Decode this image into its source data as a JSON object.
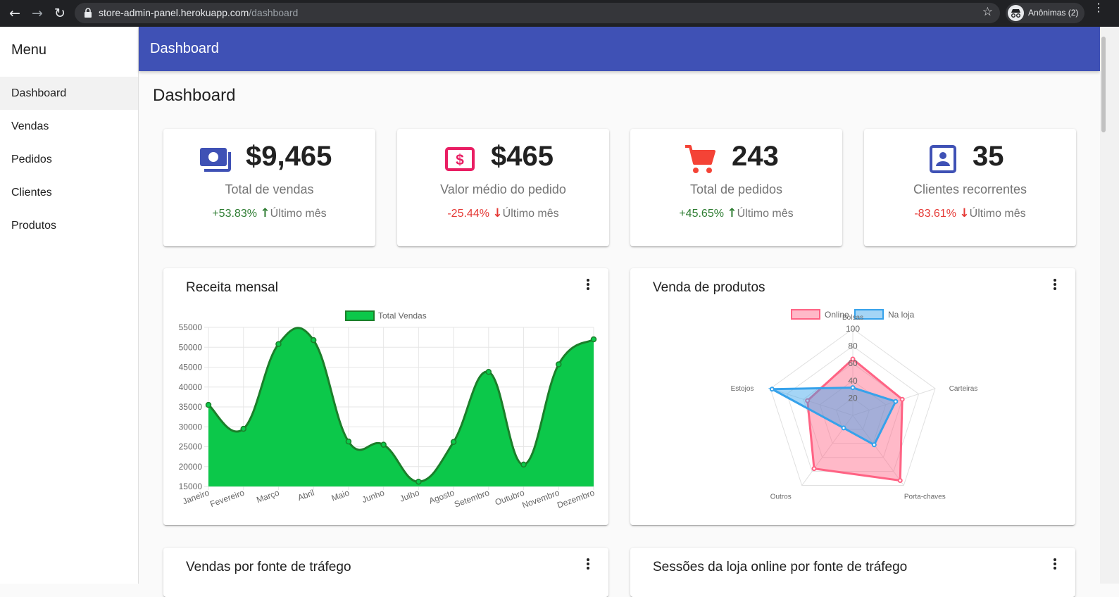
{
  "browser": {
    "url_host": "store-admin-panel.herokuapp.com",
    "url_path": "/dashboard",
    "profile_label": "Anônimas (2)"
  },
  "sidebar": {
    "title": "Menu",
    "items": [
      {
        "label": "Dashboard",
        "active": true
      },
      {
        "label": "Vendas",
        "active": false
      },
      {
        "label": "Pedidos",
        "active": false
      },
      {
        "label": "Clientes",
        "active": false
      },
      {
        "label": "Produtos",
        "active": false
      }
    ]
  },
  "appbar": {
    "title": "Dashboard"
  },
  "page": {
    "heading": "Dashboard"
  },
  "stats": [
    {
      "icon": "money-icon",
      "value": "$9,465",
      "label": "Total de vendas",
      "change": "+53.83%",
      "direction": "up",
      "period": "Último mês",
      "color": "#3f51b5"
    },
    {
      "icon": "dollar-icon",
      "value": "$465",
      "label": "Valor médio do pedido",
      "change": "-25.44%",
      "direction": "down",
      "period": "Último mês",
      "color": "#e91e63"
    },
    {
      "icon": "cart-icon",
      "value": "243",
      "label": "Total de pedidos",
      "change": "+45.65%",
      "direction": "up",
      "period": "Último mês",
      "color": "#f44336"
    },
    {
      "icon": "contact-icon",
      "value": "35",
      "label": "Clientes recorrentes",
      "change": "-83.61%",
      "direction": "down",
      "period": "Último mês",
      "color": "#3f51b5"
    }
  ],
  "cards": {
    "revenue_title": "Receita mensal",
    "products_title": "Venda de produtos",
    "traffic_title": "Vendas por fonte de tráfego",
    "sessions_title": "Sessões da loja online por fonte de tráfego"
  },
  "chart_data": [
    {
      "type": "area",
      "title": "Receita mensal",
      "series": [
        {
          "name": "Total Vendas",
          "color": "#0cc84a",
          "values": [
            35500,
            29500,
            50800,
            51800,
            26300,
            25500,
            16200,
            26200,
            43800,
            20500,
            45700,
            52000
          ]
        }
      ],
      "categories": [
        "Janeiro",
        "Fevereiro",
        "Março",
        "Abril",
        "Maio",
        "Junho",
        "Julho",
        "Agosto",
        "Setembro",
        "Outubro",
        "Novembro",
        "Dezembro"
      ],
      "yticks": [
        "15000",
        "20000",
        "25000",
        "30000",
        "35000",
        "40000",
        "45000",
        "50000",
        "55000"
      ],
      "ylim": [
        15000,
        55000
      ],
      "grid": true,
      "legend": "top-center"
    },
    {
      "type": "radar",
      "title": "Venda de produtos",
      "axes": [
        "Bolsas",
        "Carteiras",
        "Porta-chaves",
        "Outros",
        "Estojos"
      ],
      "rticks": [
        "20",
        "40",
        "60",
        "80",
        "100"
      ],
      "rlim": [
        0,
        100
      ],
      "series": [
        {
          "name": "Online",
          "color": "#ff6384",
          "values": [
            65,
            60,
            93,
            76,
            55
          ]
        },
        {
          "name": "Na loja",
          "color": "#36a2eb",
          "values": [
            32,
            52,
            42,
            18,
            98
          ]
        }
      ],
      "legend": "top-center"
    }
  ]
}
